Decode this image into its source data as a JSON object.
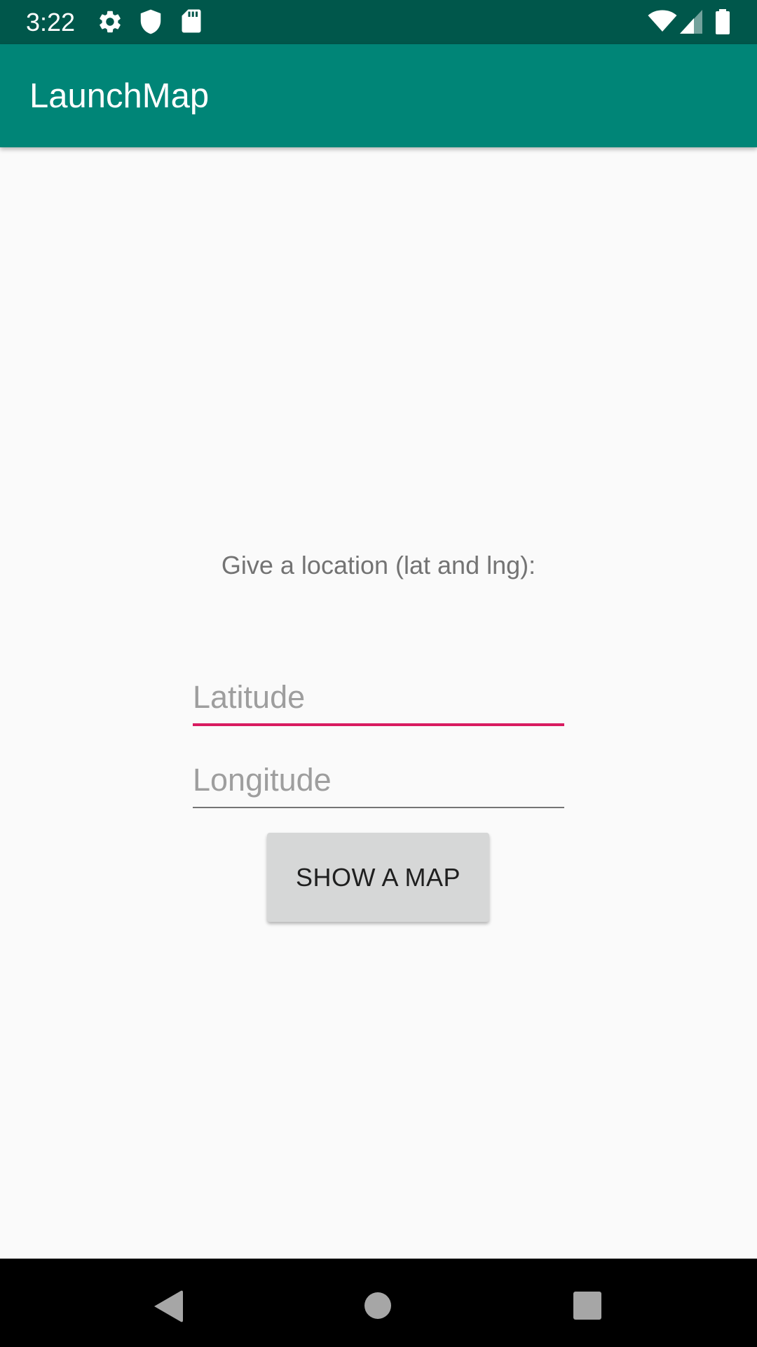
{
  "status_bar": {
    "time": "3:22",
    "left_icons": [
      "gear-icon",
      "shield-icon",
      "sd-card-icon"
    ],
    "right_icons": [
      "wifi-icon",
      "cell-signal-icon",
      "battery-icon"
    ],
    "background": "#00574b"
  },
  "app_bar": {
    "title": "LaunchMap",
    "background": "#008577"
  },
  "form": {
    "prompt": "Give a location (lat and lng):",
    "latitude_placeholder": "Latitude",
    "latitude_value": "",
    "longitude_placeholder": "Longitude",
    "longitude_value": "",
    "accent_color": "#d81b60",
    "show_button_label": "SHOW A MAP"
  },
  "nav_bar": {
    "buttons": [
      "back-icon",
      "home-icon",
      "recents-icon"
    ]
  }
}
